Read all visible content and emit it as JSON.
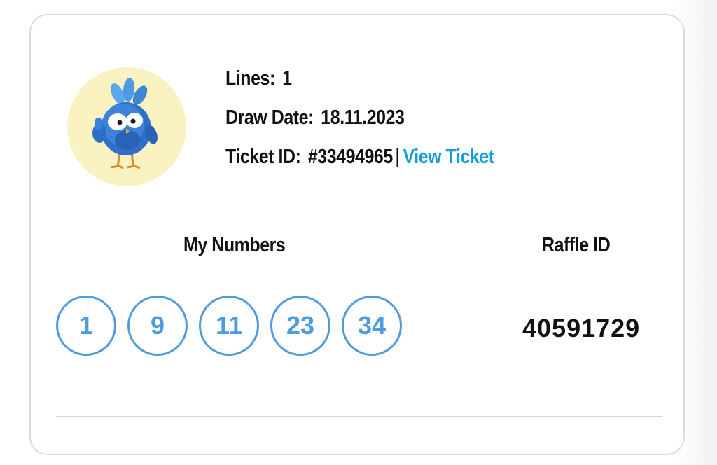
{
  "ticket": {
    "lines_label": "Lines:",
    "lines_value": "1",
    "draw_date_label": "Draw Date:",
    "draw_date_value": "18.11.2023",
    "ticket_id_label": "Ticket ID:",
    "ticket_id_value": "#33494965",
    "separator": "|",
    "view_ticket_label": "View Ticket"
  },
  "numbers": {
    "heading": "My Numbers",
    "balls": [
      "1",
      "9",
      "11",
      "23",
      "34"
    ]
  },
  "raffle": {
    "heading": "Raffle ID",
    "value": "40591729"
  },
  "avatar": {
    "icon": "bird-mascot-thumbs-up-icon"
  },
  "colors": {
    "link": "#1a9dd6",
    "ball": "#4f9be2",
    "avatar_bg": "#fbf2c2",
    "text": "#111111"
  }
}
